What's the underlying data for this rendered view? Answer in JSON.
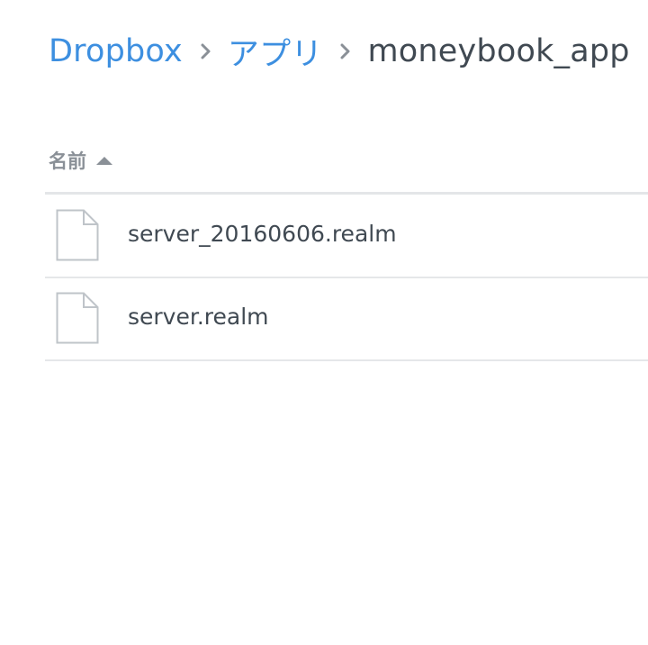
{
  "breadcrumb": {
    "items": [
      {
        "label": "Dropbox"
      },
      {
        "label": "アプリ"
      }
    ],
    "current": "moneybook_app"
  },
  "list_header": {
    "sort_label": "名前",
    "sort_direction": "ascending"
  },
  "files": [
    {
      "name": "server_20160606.realm",
      "icon": "file-icon"
    },
    {
      "name": "server.realm",
      "icon": "file-icon"
    }
  ],
  "colors": {
    "link": "#3d8fe0",
    "text": "#404952",
    "muted": "#8a9097",
    "divider": "#e5e7e9"
  }
}
